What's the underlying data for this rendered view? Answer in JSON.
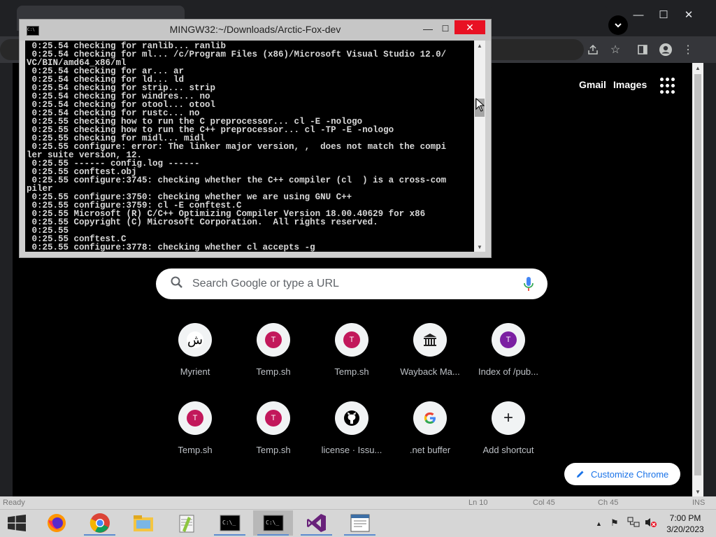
{
  "chrome": {
    "window_controls": {
      "minimize": "—",
      "maximize": "☐",
      "close": "✕"
    },
    "profile_initial": "✓"
  },
  "ntp": {
    "gmail_label": "Gmail",
    "images_label": "Images",
    "search_placeholder": "Search Google or type a URL",
    "shortcuts": [
      {
        "label": "Myrient",
        "icon": "myrient-logo",
        "letter": "ﺵ",
        "color": "#ffffff",
        "text_color": "#000000"
      },
      {
        "label": "Temp.sh",
        "icon": "letter-t",
        "letter": "T",
        "color": "#c2185b",
        "text_color": "#ffffff"
      },
      {
        "label": "Temp.sh",
        "icon": "letter-t",
        "letter": "T",
        "color": "#c2185b",
        "text_color": "#ffffff"
      },
      {
        "label": "Wayback Ma...",
        "icon": "archive-building",
        "letter": "🏛",
        "color": "#ffffff",
        "text_color": "#000000"
      },
      {
        "label": "Index of /pub...",
        "icon": "letter-t",
        "letter": "T",
        "color": "#7b1fa2",
        "text_color": "#ffffff"
      },
      {
        "label": "Temp.sh",
        "icon": "letter-t",
        "letter": "T",
        "color": "#c2185b",
        "text_color": "#ffffff"
      },
      {
        "label": "Temp.sh",
        "icon": "letter-t",
        "letter": "T",
        "color": "#c2185b",
        "text_color": "#ffffff"
      },
      {
        "label": "license · Issu...",
        "icon": "github-icon",
        "letter": "",
        "color": "#ffffff",
        "text_color": "#000000"
      },
      {
        "label": ".net buffer",
        "icon": "google-g-icon",
        "letter": "G",
        "color": "#ffffff",
        "text_color": "#4285f4"
      },
      {
        "label": "Add shortcut",
        "icon": "plus-icon",
        "letter": "+",
        "color": "#f1f3f4",
        "text_color": "#202124"
      }
    ],
    "customize_label": "Customize Chrome"
  },
  "statusbar": {
    "ready": "Ready",
    "ln": "Ln 10",
    "col": "Col 45",
    "ch": "Ch 45",
    "ins": "INS"
  },
  "terminal": {
    "title": "MINGW32:~/Downloads/Arctic-Fox-dev",
    "controls": {
      "minimize": "—",
      "maximize": "☐",
      "close": "✕"
    },
    "lines": [
      " 0:25.54 checking for ranlib... ranlib",
      " 0:25.54 checking for ml... /c/Program Files (x86)/Microsoft Visual Studio 12.0/",
      "VC/BIN/amd64_x86/ml",
      " 0:25.54 checking for ar... ar",
      " 0:25.54 checking for ld... ld",
      " 0:25.54 checking for strip... strip",
      " 0:25.54 checking for windres... no",
      " 0:25.54 checking for otool... otool",
      " 0:25.54 checking for rustc... no",
      " 0:25.55 checking how to run the C preprocessor... cl -E -nologo",
      " 0:25.55 checking how to run the C++ preprocessor... cl -TP -E -nologo",
      " 0:25.55 checking for midl... midl",
      " 0:25.55 configure: error: The linker major version, ,  does not match the compi",
      "ler suite version, 12.",
      " 0:25.55 ------ config.log ------",
      " 0:25.55 conftest.obj",
      " 0:25.55 configure:3745: checking whether the C++ compiler (cl  ) is a cross-com",
      "piler",
      " 0:25.55 configure:3750: checking whether we are using GNU C++",
      " 0:25.55 configure:3759: cl -E conftest.C",
      " 0:25.55 Microsoft (R) C/C++ Optimizing Compiler Version 18.00.40629 for x86",
      " 0:25.55 Copyright (C) Microsoft Corporation.  All rights reserved.",
      " 0:25.55",
      " 0:25.55 conftest.C",
      " 0:25.55 configure:3778: checking whether cl accepts -g"
    ],
    "scroll_position_fraction": 0.28
  },
  "taskbar": {
    "apps": [
      {
        "name": "firefox"
      },
      {
        "name": "chrome"
      },
      {
        "name": "file-explorer"
      },
      {
        "name": "notepad-plus-plus"
      },
      {
        "name": "command-prompt"
      },
      {
        "name": "mingw-terminal"
      },
      {
        "name": "visual-studio"
      },
      {
        "name": "document-viewer"
      }
    ],
    "tray": {
      "chevron": "▲",
      "flag": "⚑",
      "network": "🖧",
      "volume": "🔇"
    },
    "clock": {
      "time": "7:00 PM",
      "date": "3/20/2023"
    }
  }
}
